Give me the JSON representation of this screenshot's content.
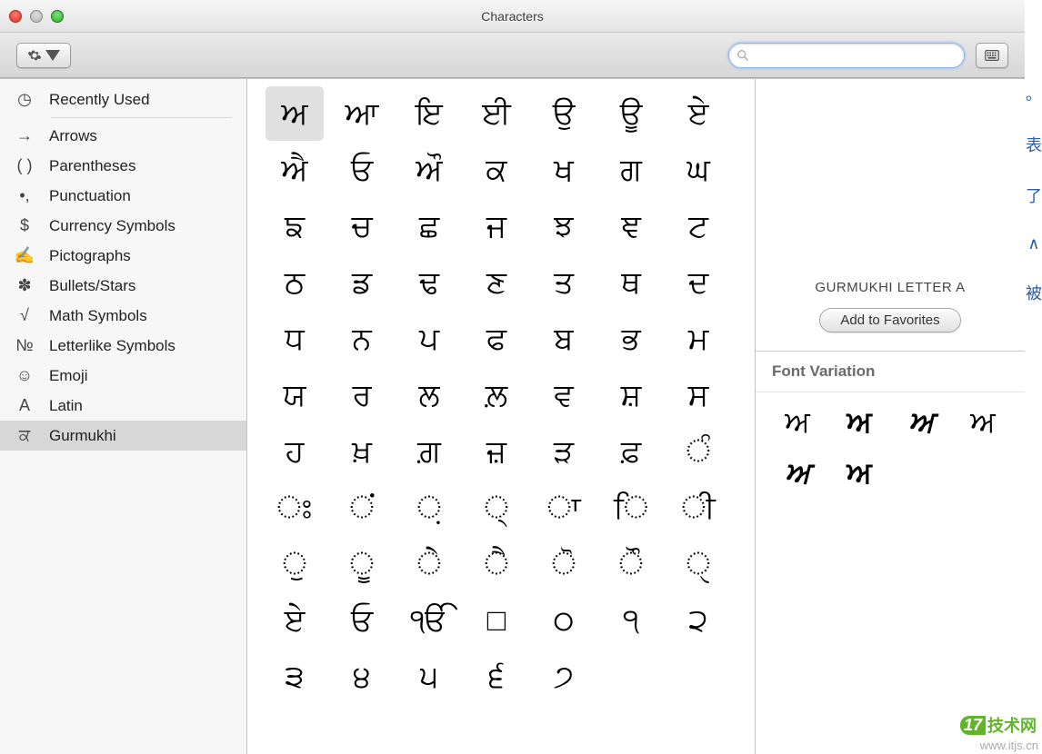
{
  "window_title": "Characters",
  "search": {
    "placeholder": ""
  },
  "categories": [
    {
      "icon_name": "clock-icon",
      "glyph": "◷",
      "label": "Recently Used"
    },
    {
      "icon_name": "arrow-icon",
      "glyph": "→",
      "label": "Arrows"
    },
    {
      "icon_name": "parens-icon",
      "glyph": "( )",
      "label": "Parentheses"
    },
    {
      "icon_name": "punct-icon",
      "glyph": "•,",
      "label": "Punctuation"
    },
    {
      "icon_name": "currency-icon",
      "glyph": "$",
      "label": "Currency Symbols"
    },
    {
      "icon_name": "pictograph-icon",
      "glyph": "✍",
      "label": "Pictographs"
    },
    {
      "icon_name": "bullets-icon",
      "glyph": "✽",
      "label": "Bullets/Stars"
    },
    {
      "icon_name": "math-icon",
      "glyph": "√",
      "label": "Math Symbols"
    },
    {
      "icon_name": "letterlike-icon",
      "glyph": "№",
      "label": "Letterlike Symbols"
    },
    {
      "icon_name": "emoji-icon",
      "glyph": "☺",
      "label": "Emoji"
    },
    {
      "icon_name": "latin-icon",
      "glyph": "A",
      "label": "Latin"
    },
    {
      "icon_name": "gurmukhi-icon",
      "glyph": "ਕ",
      "label": "Gurmukhi",
      "selected": true
    }
  ],
  "chars": [
    "ਅ",
    "ਆ",
    "ਇ",
    "ਈ",
    "ਉ",
    "ਊ",
    "ਏ",
    "ਐ",
    "ਓ",
    "ਔ",
    "ਕ",
    "ਖ",
    "ਗ",
    "ਘ",
    "ਙ",
    "ਚ",
    "ਛ",
    "ਜ",
    "ਝ",
    "ਞ",
    "ਟ",
    "ਠ",
    "ਡ",
    "ਢ",
    "ਣ",
    "ਤ",
    "ਥ",
    "ਦ",
    "ਧ",
    "ਨ",
    "ਪ",
    "ਫ",
    "ਬ",
    "ਭ",
    "ਮ",
    "ਯ",
    "ਰ",
    "ਲ",
    "ਲ਼",
    "ਵ",
    "ਸ਼",
    "ਸ",
    "ਹ",
    "ਖ਼",
    "ਗ਼",
    "ਜ਼",
    "ੜ",
    "ਫ਼",
    "ੰ",
    "ਃ",
    "ਂ",
    "਼",
    "੍",
    "ਾ",
    "ਿ",
    "ੀ",
    "ੁ",
    "ੂ",
    "ੇ",
    "ੈ",
    "ੋ",
    "ੌ",
    "ੑ",
    "ਏ",
    "ਓ",
    "ੴ",
    "□",
    "੦",
    "੧",
    "੨",
    "੩",
    "੪",
    "੫",
    "੬",
    "੭"
  ],
  "selected_index": 0,
  "detail": {
    "name": "GURMUKHI LETTER A",
    "favorites_label": "Add to Favorites",
    "variation_label": "Font Variation",
    "variations": [
      "ਅ",
      "ਅ",
      "ਅ",
      "ਅ",
      "ਅ",
      "ਅ"
    ]
  },
  "watermark": {
    "a": "17",
    "b": "技术网",
    "url": "www.itjs.cn"
  },
  "edge_chars": [
    "。",
    "表",
    "了",
    "∧",
    "被"
  ]
}
